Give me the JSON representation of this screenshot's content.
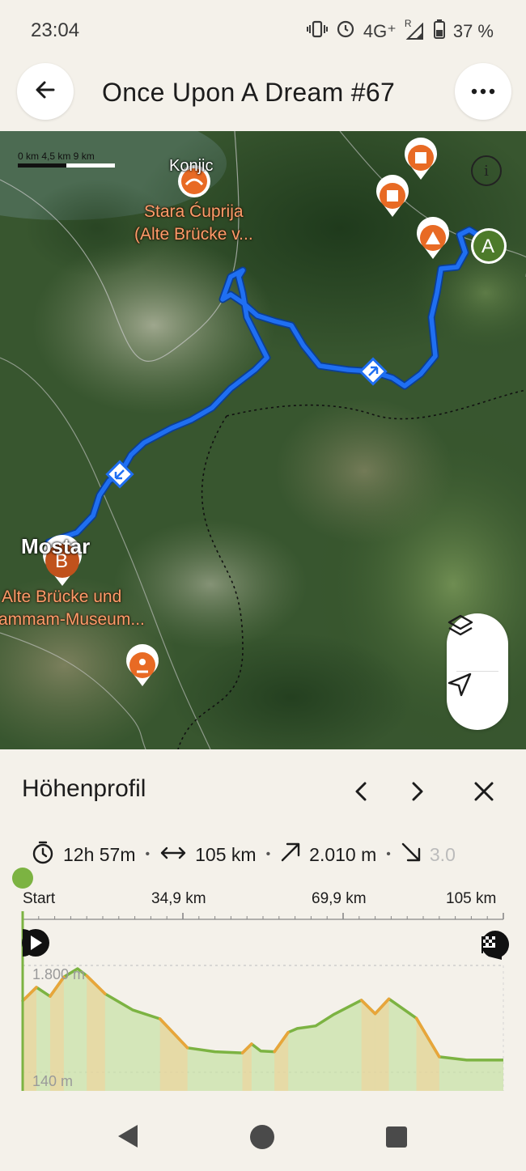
{
  "status_bar": {
    "time": "23:04",
    "network": "4G⁺",
    "roaming": "R",
    "battery": "37 %"
  },
  "header": {
    "title": "Once Upon A Dream #67"
  },
  "map": {
    "scale": "0 km 4,5 km 9 km",
    "places": {
      "konjic": "Konjic",
      "stara_cuprija_line1": "Stara Ćuprija",
      "stara_cuprija_line2": "(Alte Brücke v...",
      "mostar": "Mostar",
      "alte_bruecke_line1": "Alte Brücke und",
      "alte_bruecke_line2": "ammam-Museum..."
    },
    "markers": {
      "start": "A",
      "end": "B"
    },
    "info_symbol": "i"
  },
  "elevation": {
    "title": "Höhenprofil",
    "stats": {
      "duration": "12h 57m",
      "distance": "105 km",
      "ascent": "2.010 m",
      "descent": "3.0"
    },
    "axis": [
      "Start",
      "34,9 km",
      "69,9 km",
      "105 km"
    ],
    "max_label": "1.800 m",
    "min_label": "140 m",
    "profile_points_m": [
      [
        0,
        1250
      ],
      [
        3,
        1460
      ],
      [
        6,
        1320
      ],
      [
        9,
        1620
      ],
      [
        12,
        1750
      ],
      [
        14,
        1640
      ],
      [
        18,
        1360
      ],
      [
        24,
        1110
      ],
      [
        30,
        970
      ],
      [
        36,
        520
      ],
      [
        42,
        460
      ],
      [
        48,
        440
      ],
      [
        50,
        580
      ],
      [
        52,
        470
      ],
      [
        55,
        460
      ],
      [
        58,
        760
      ],
      [
        60,
        820
      ],
      [
        64,
        860
      ],
      [
        68,
        1040
      ],
      [
        74,
        1260
      ],
      [
        77,
        1050
      ],
      [
        80,
        1280
      ],
      [
        86,
        980
      ],
      [
        91,
        380
      ],
      [
        97,
        330
      ],
      [
        105,
        330
      ]
    ],
    "colors": {
      "profile_line": "#7cb342",
      "profile_fill": "#c9e2a8",
      "steep": "#f29b7a",
      "moderate": "#f4cf98"
    }
  }
}
